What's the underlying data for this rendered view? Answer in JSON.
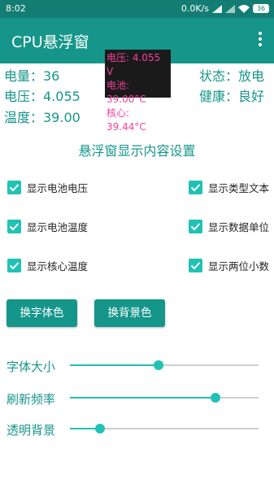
{
  "status_bar": {
    "time": "8:02",
    "net_speed": "0.0K/s",
    "battery": "36"
  },
  "app_bar": {
    "title": "CPU悬浮窗"
  },
  "info": {
    "level": "电量：36",
    "voltage": "电压：4.055",
    "temperature": "温度：39.00",
    "state": "状态：放电",
    "health": "健康：良好"
  },
  "overlay": {
    "voltage": "电压: 4.055 V",
    "battery_temp": "电池: 39.00°C",
    "core_temp": "核心: 39.44°C",
    "text_color": "#f0429b"
  },
  "settings": {
    "title": "悬浮窗显示内容设置",
    "checkboxes": [
      {
        "label": "显示电池电压",
        "checked": true
      },
      {
        "label": "显示类型文本",
        "checked": true
      },
      {
        "label": "显示电池温度",
        "checked": true
      },
      {
        "label": "显示数据单位",
        "checked": true
      },
      {
        "label": "显示核心温度",
        "checked": true
      },
      {
        "label": "显示两位小数",
        "checked": true
      }
    ],
    "buttons": {
      "font_color": "换字体色",
      "bg_color": "换背景色"
    },
    "sliders": [
      {
        "label": "字体大小",
        "value": 0.47
      },
      {
        "label": "刷新频率",
        "value": 0.77
      },
      {
        "label": "透明背景",
        "value": 0.16
      }
    ]
  },
  "colors": {
    "primary": "#16968a",
    "status_bar": "#137d73",
    "accent": "#20c2b4"
  }
}
